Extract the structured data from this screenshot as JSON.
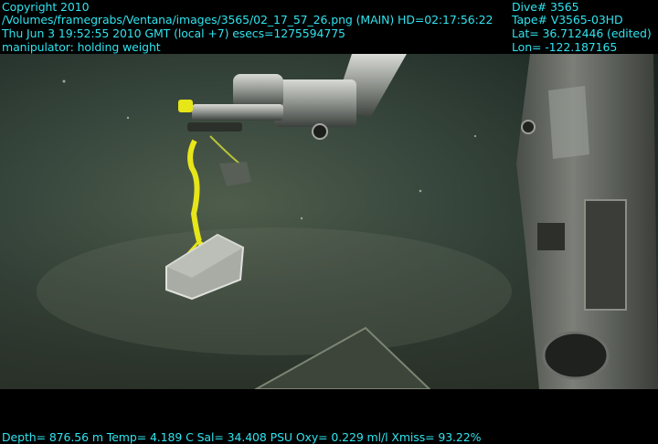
{
  "header_left": {
    "line1": "Copyright 2010",
    "line2": "/Volumes/framegrabs/Ventana/images/3565/02_17_57_26.png (MAIN)  HD=02:17:56:22",
    "line3": "Thu Jun  3 19:52:55 2010 GMT (local +7)  esecs=1275594775",
    "line4": "manipulator: holding weight"
  },
  "header_right": {
    "dive": "Dive# 3565",
    "tape": "Tape# V3565-03HD",
    "lat": "Lat= 36.712446 (edited)",
    "lon": "Lon= -122.187165"
  },
  "footer": {
    "telemetry": "Depth= 876.56 m  Temp= 4.189 C  Sal= 34.408 PSU  Oxy= 0.229 ml/l  Xmiss= 93.22%"
  },
  "colors": {
    "overlay_text": "#2fe3ee",
    "water": "#2e3a33",
    "rope": "#e6e619"
  }
}
